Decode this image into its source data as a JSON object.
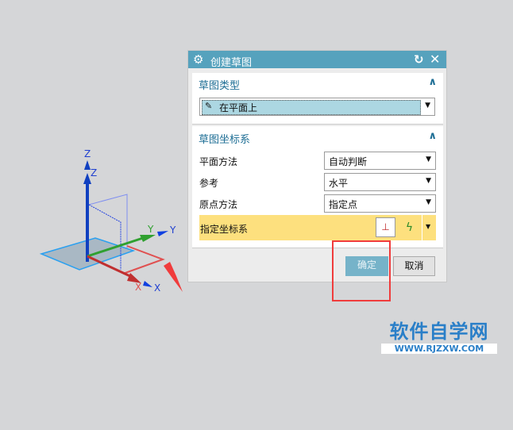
{
  "dialog": {
    "title": "创建草图",
    "icons": [
      "settings-icon",
      "reset-icon",
      "close-icon"
    ],
    "section1": {
      "header": "草图类型",
      "type_value": "在平面上"
    },
    "section2": {
      "header": "草图坐标系",
      "rows": [
        {
          "label": "平面方法",
          "value": "自动判断"
        },
        {
          "label": "参考",
          "value": "水平"
        },
        {
          "label": "原点方法",
          "value": "指定点"
        }
      ],
      "csys_label": "指定坐标系"
    },
    "ok_label": "确定",
    "cancel_label": "取消"
  },
  "viewport": {
    "axis_labels": {
      "z1": "Z",
      "z2": "Z",
      "y1": "Y",
      "y2": "Y",
      "x1": "X",
      "x2": "X"
    }
  },
  "watermark": {
    "title": "软件自学网",
    "url": "WWW.RJZXW.COM"
  },
  "colors": {
    "title_bar": "#56a2bd",
    "highlight": "#fde07e",
    "ok_button": "#76b3c9",
    "annotation": "#f03c3c"
  }
}
